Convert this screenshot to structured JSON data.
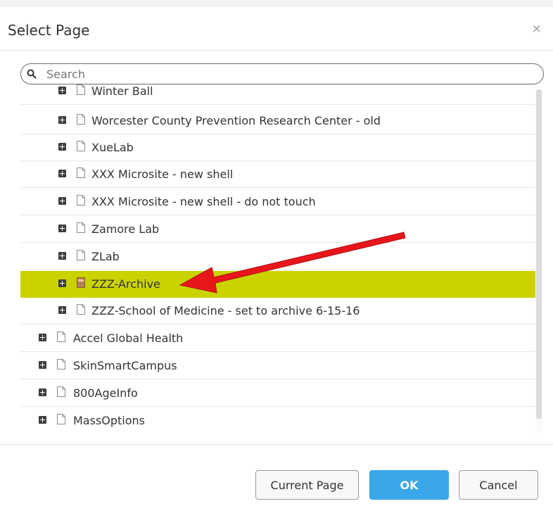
{
  "dialog": {
    "title": "Select Page",
    "close_icon": "×"
  },
  "search": {
    "placeholder": "Search",
    "icon": "search-icon"
  },
  "tree": {
    "items": [
      {
        "label": "Winter Ball",
        "level": 2
      },
      {
        "label": "Worcester County Prevention Research Center - old",
        "level": 2
      },
      {
        "label": "XueLab",
        "level": 2
      },
      {
        "label": "XXX Microsite - new shell",
        "level": 2
      },
      {
        "label": "XXX Microsite - new shell - do not touch",
        "level": 2
      },
      {
        "label": "Zamore Lab",
        "level": 2
      },
      {
        "label": "ZLab",
        "level": 2
      },
      {
        "label": "ZZZ-Archive",
        "level": 2,
        "selected": true,
        "icon": "archive-page-icon"
      },
      {
        "label": "ZZZ-School of Medicine - set to archive 6-15-16",
        "level": 2
      },
      {
        "label": "Accel Global Health",
        "level": 1
      },
      {
        "label": "SkinSmartCampus",
        "level": 1
      },
      {
        "label": "800AgeInfo",
        "level": 1
      },
      {
        "label": "MassOptions",
        "level": 1
      }
    ]
  },
  "buttons": {
    "current_page": "Current Page",
    "ok": "OK",
    "cancel": "Cancel"
  },
  "colors": {
    "selected_row": "#cad300",
    "ok_button": "#3aa7ea",
    "annotation_arrow": "#e8161b"
  }
}
